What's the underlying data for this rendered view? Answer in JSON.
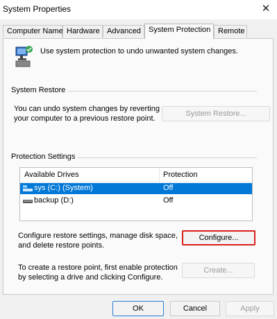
{
  "window": {
    "title": "System Properties",
    "close_glyph": "✕"
  },
  "tabs": [
    {
      "label": "Computer Name"
    },
    {
      "label": "Hardware"
    },
    {
      "label": "Advanced"
    },
    {
      "label": "System Protection"
    },
    {
      "label": "Remote"
    }
  ],
  "active_tab": "System Protection",
  "intro_text": "Use system protection to undo unwanted system changes.",
  "system_restore": {
    "group_label": "System Restore",
    "description_line1": "You can undo system changes by reverting",
    "description_line2": "your computer to a previous restore point.",
    "button_label": "System Restore..."
  },
  "protection_settings": {
    "group_label": "Protection Settings",
    "columns": {
      "drives": "Available Drives",
      "protection": "Protection"
    },
    "drives": [
      {
        "name": "sys (C:) (System)",
        "protection": "Off",
        "selected": true,
        "icon": "system-drive-icon"
      },
      {
        "name": "backup (D:)",
        "protection": "Off",
        "selected": false,
        "icon": "drive-icon"
      }
    ],
    "configure_text_line1": "Configure restore settings, manage disk space,",
    "configure_text_line2": "and delete restore points.",
    "configure_button": "Configure...",
    "create_text_line1": "To create a restore point, first enable protection",
    "create_text_line2": "by selecting a drive and clicking Configure.",
    "create_button": "Create..."
  },
  "footer": {
    "ok": "OK",
    "cancel": "Cancel",
    "apply": "Apply"
  },
  "colors": {
    "selection": "#0078d7",
    "highlight_border": "#d91e18",
    "accent": "#2a7ed3"
  }
}
